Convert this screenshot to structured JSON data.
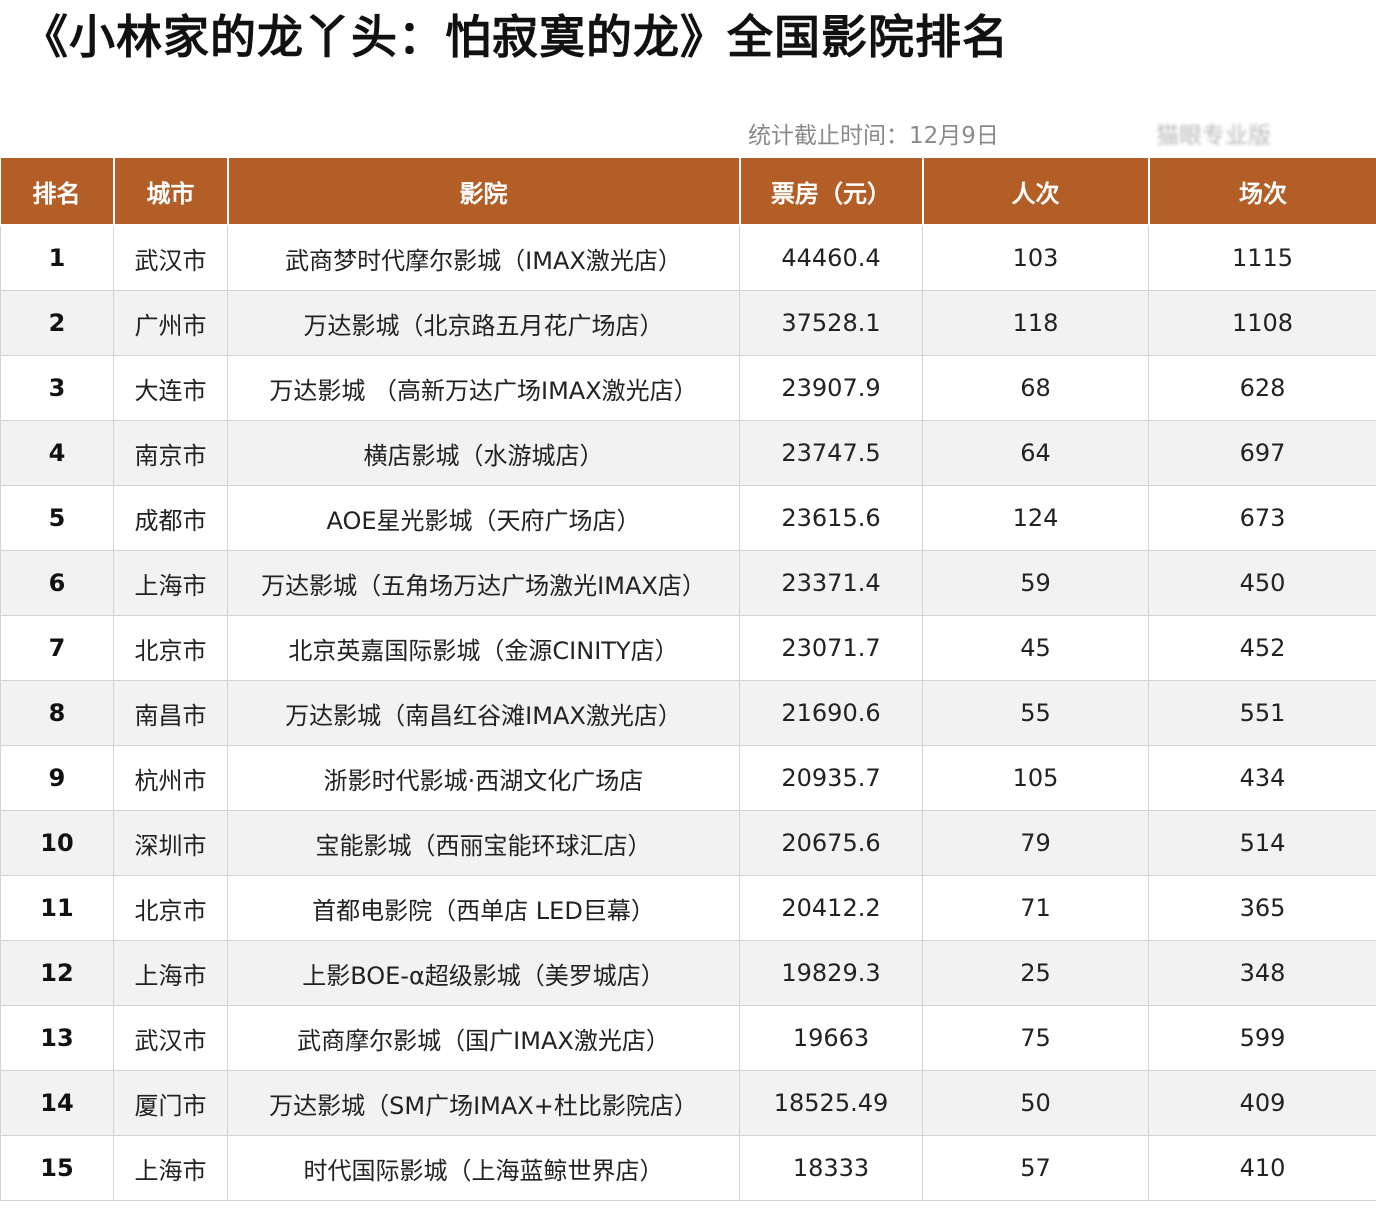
{
  "title": "《小林家的龙丫头：怕寂寞的龙》全国影院排名",
  "stat_date": "统计截止时间：12月9日",
  "watermark": "猫眼专业版",
  "table": {
    "headers": [
      "排名",
      "城市",
      "影院",
      "票房（元）",
      "人次",
      "场次"
    ],
    "rows": [
      {
        "rank": "1",
        "city": "武汉市",
        "cinema": "武商梦时代摩尔影城（IMAX激光店）",
        "box": "44460.4",
        "people": "103",
        "shows": "1115"
      },
      {
        "rank": "2",
        "city": "广州市",
        "cinema": "万达影城（北京路五月花广场店）",
        "box": "37528.1",
        "people": "118",
        "shows": "1108"
      },
      {
        "rank": "3",
        "city": "大连市",
        "cinema": "万达影城 （高新万达广场IMAX激光店）",
        "box": "23907.9",
        "people": "68",
        "shows": "628"
      },
      {
        "rank": "4",
        "city": "南京市",
        "cinema": "横店影城（水游城店）",
        "box": "23747.5",
        "people": "64",
        "shows": "697"
      },
      {
        "rank": "5",
        "city": "成都市",
        "cinema": "AOE星光影城（天府广场店）",
        "box": "23615.6",
        "people": "124",
        "shows": "673"
      },
      {
        "rank": "6",
        "city": "上海市",
        "cinema": "万达影城（五角场万达广场激光IMAX店）",
        "box": "23371.4",
        "people": "59",
        "shows": "450"
      },
      {
        "rank": "7",
        "city": "北京市",
        "cinema": "北京英嘉国际影城（金源CINITY店）",
        "box": "23071.7",
        "people": "45",
        "shows": "452"
      },
      {
        "rank": "8",
        "city": "南昌市",
        "cinema": "万达影城（南昌红谷滩IMAX激光店）",
        "box": "21690.6",
        "people": "55",
        "shows": "551"
      },
      {
        "rank": "9",
        "city": "杭州市",
        "cinema": "浙影时代影城·西湖文化广场店",
        "box": "20935.7",
        "people": "105",
        "shows": "434"
      },
      {
        "rank": "10",
        "city": "深圳市",
        "cinema": "宝能影城（西丽宝能环球汇店）",
        "box": "20675.6",
        "people": "79",
        "shows": "514"
      },
      {
        "rank": "11",
        "city": "北京市",
        "cinema": "首都电影院（西单店 LED巨幕）",
        "box": "20412.2",
        "people": "71",
        "shows": "365"
      },
      {
        "rank": "12",
        "city": "上海市",
        "cinema": "上影BOE-α超级影城（美罗城店）",
        "box": "19829.3",
        "people": "25",
        "shows": "348"
      },
      {
        "rank": "13",
        "city": "武汉市",
        "cinema": "武商摩尔影城（国广IMAX激光店）",
        "box": "19663",
        "people": "75",
        "shows": "599"
      },
      {
        "rank": "14",
        "city": "厦门市",
        "cinema": "万达影城（SM广场IMAX+杜比影院店）",
        "box": "18525.49",
        "people": "50",
        "shows": "409"
      },
      {
        "rank": "15",
        "city": "上海市",
        "cinema": "时代国际影城（上海蓝鲸世界店）",
        "box": "18333",
        "people": "57",
        "shows": "410"
      }
    ]
  },
  "colors": {
    "header_bg": "#b35e26",
    "header_text": "#ffffff",
    "stripe": "#f2f2f2"
  }
}
